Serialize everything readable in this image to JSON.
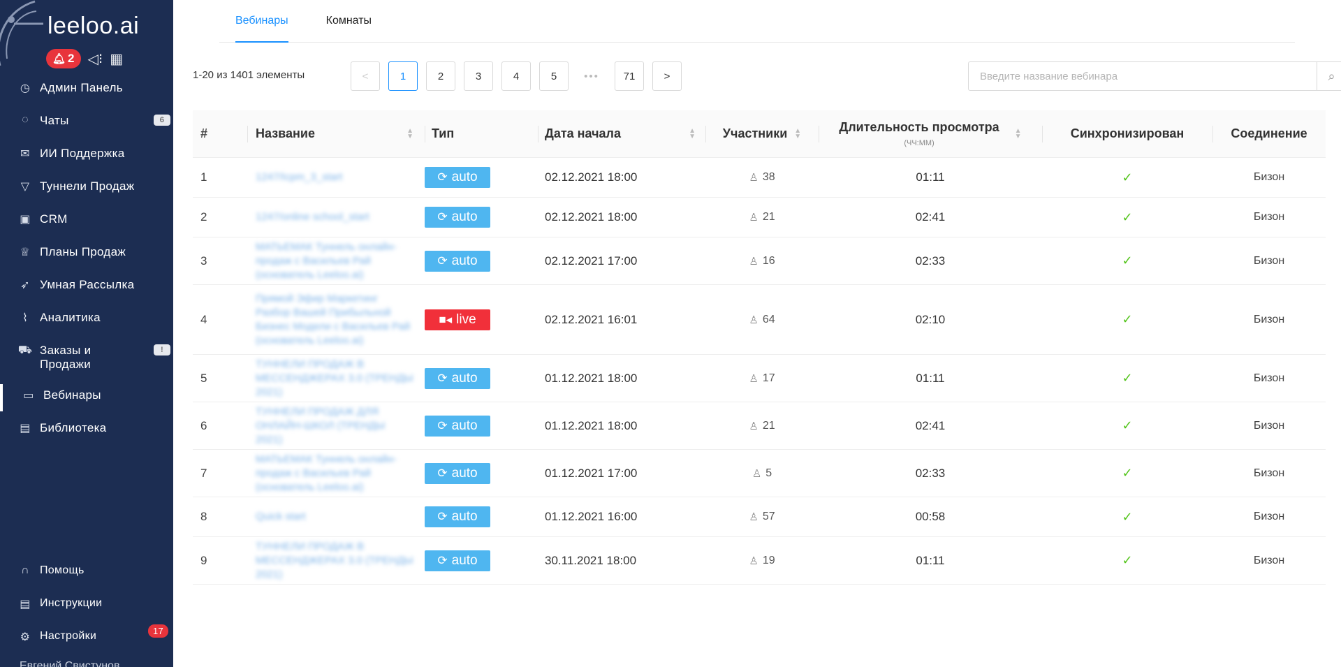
{
  "app": {
    "logo_text": "leeloo.ai",
    "notifications_count": "2",
    "user_name": "Евгений Свистунов"
  },
  "sidebar": {
    "items": [
      {
        "label": "Админ Панель",
        "icon": "dashboard-icon",
        "glyph": "◷"
      },
      {
        "label": "Чаты",
        "icon": "chat-icon",
        "glyph": "◌",
        "badge": "6"
      },
      {
        "label": "ИИ Поддержка",
        "icon": "mail-icon",
        "glyph": "✉"
      },
      {
        "label": "Туннели Продаж",
        "icon": "funnel-icon",
        "glyph": "▽"
      },
      {
        "label": "CRM",
        "icon": "crm-icon",
        "glyph": "▣"
      },
      {
        "label": "Планы Продаж",
        "icon": "trophy-icon",
        "glyph": "♕"
      },
      {
        "label": "Умная Рассылка",
        "icon": "rocket-icon",
        "glyph": "➶"
      },
      {
        "label": "Аналитика",
        "icon": "chart-icon",
        "glyph": "⌇"
      },
      {
        "label": "Заказы и Продажи",
        "icon": "cart-icon",
        "glyph": "⛟",
        "badge": "!"
      },
      {
        "label": "Вебинары",
        "icon": "video-icon",
        "glyph": "▭",
        "active": true
      },
      {
        "label": "Библиотека",
        "icon": "book-icon",
        "glyph": "▤"
      }
    ],
    "bottom": [
      {
        "label": "Помощь",
        "icon": "headset-icon",
        "glyph": "∩"
      },
      {
        "label": "Инструкции",
        "icon": "document-icon",
        "glyph": "▤"
      },
      {
        "label": "Настройки",
        "icon": "gear-icon",
        "glyph": "⚙",
        "badge": "17"
      }
    ]
  },
  "tabs": [
    {
      "label": "Вебинары",
      "active": true
    },
    {
      "label": "Комнаты",
      "active": false
    }
  ],
  "toolbar": {
    "range_text": "1-20 из 1401 элементы",
    "pages": [
      "1",
      "2",
      "3",
      "4",
      "5",
      "•••",
      "71"
    ],
    "current_page": "1",
    "prev": "<",
    "next": ">",
    "search_placeholder": "Введите название вебинара"
  },
  "table": {
    "headers": {
      "num": "#",
      "name": "Название",
      "type": "Тип",
      "date": "Дата начала",
      "participants": "Участники",
      "duration": "Длительность просмотра",
      "duration_sub": "(ЧЧ:ММ)",
      "sync": "Синхронизирован",
      "connection": "Соединение"
    },
    "rows": [
      {
        "num": "1",
        "name": "1247/Icpm_3_start",
        "type": "auto",
        "date": "02.12.2021 18:00",
        "participants": "38",
        "duration": "01:11",
        "connection": "Бизон",
        "h": 57
      },
      {
        "num": "2",
        "name": "1247/online school_start",
        "type": "auto",
        "date": "02.12.2021 18:00",
        "participants": "21",
        "duration": "02:41",
        "connection": "Бизон",
        "h": 57
      },
      {
        "num": "3",
        "name": "МАТЬЕМАК Туннель онлайн-продаж с Васильев Рай (основатель Leeloo.ai)",
        "type": "auto",
        "date": "02.12.2021 17:00",
        "participants": "16",
        "duration": "02:33",
        "connection": "Бизон",
        "h": 68
      },
      {
        "num": "4",
        "name": "Прямой Эфир Маркетинг Разбор Вашей Прибыльной Бизнес Модели с Васильев Рай (основатель Leeloo.ai)",
        "type": "live",
        "date": "02.12.2021 16:01",
        "participants": "64",
        "duration": "02:10",
        "connection": "Бизон",
        "h": 100
      },
      {
        "num": "5",
        "name": "ТУННЕЛИ ПРОДАЖ В МЕССЕНДЖЕРАХ 3.0 (ТРЕНДЫ 2021)",
        "type": "auto",
        "date": "01.12.2021 18:00",
        "participants": "17",
        "duration": "01:11",
        "connection": "Бизон",
        "h": 68
      },
      {
        "num": "6",
        "name": "ТУННЕЛИ ПРОДАЖ ДЛЯ ОНЛАЙН-ШКОЛ (ТРЕНДЫ 2021)",
        "type": "auto",
        "date": "01.12.2021 18:00",
        "participants": "21",
        "duration": "02:41",
        "connection": "Бизон",
        "h": 68
      },
      {
        "num": "7",
        "name": "МАТЬЕМАК Туннель онлайн-продаж с Васильев Рай (основатель Leeloo.ai)",
        "type": "auto",
        "date": "01.12.2021 17:00",
        "participants": "5",
        "duration": "02:33",
        "connection": "Бизон",
        "h": 68
      },
      {
        "num": "8",
        "name": "Quick start",
        "type": "auto",
        "date": "01.12.2021 16:00",
        "participants": "57",
        "duration": "00:58",
        "connection": "Бизон",
        "h": 57
      },
      {
        "num": "9",
        "name": "ТУННЕЛИ ПРОДАЖ В МЕССЕНДЖЕРАХ 3.0 (ТРЕНДЫ 2021)",
        "type": "auto",
        "date": "30.11.2021 18:00",
        "participants": "19",
        "duration": "01:11",
        "connection": "Бизон",
        "h": 68
      }
    ]
  },
  "colors": {
    "sidebar_bg": "#1c2d52",
    "accent": "#1890ff",
    "auto_badge": "#4fb6f0",
    "live_badge": "#f1303a",
    "check": "#52c41a"
  }
}
